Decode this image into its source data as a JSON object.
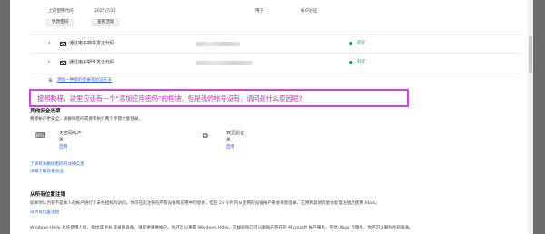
{
  "top": {
    "last_used_label": "上次使用时间",
    "last_used_value": "2025/7/20",
    "type_label": "用于",
    "type_value": "帐户验证",
    "change_password_btn": "更改密码",
    "view_activity_btn": "查看活动"
  },
  "methods": [
    {
      "label": "通过电子邮件发送代码",
      "status": "验证"
    },
    {
      "label": "通过电子邮件发送代码",
      "status": "验证"
    }
  ],
  "add_method_link": "添加一种新的登录或验证方法",
  "annotation": "按照教程，这里应该有一个“添加应用密码”的框块，但是我的帐号没有，请问是什么原因呢?",
  "advanced": {
    "title": "其他安全选项",
    "desc": "要使帐户更安全，请删除密码或要求执行两个步骤才能登录。",
    "passwordless": {
      "title": "无密码帐户",
      "state": "关",
      "action": "启用"
    },
    "two_step": {
      "title": "双重验证",
      "state": "关",
      "action": "启用"
    },
    "link1": "了解有关删除密码的详细信息",
    "link2": "详细了解双重验证"
  },
  "sign_out": {
    "title": "从所有位置注销",
    "desc": "如果你认为有不是本人的帐户进行了未经授权的访问，你可在此注销在所有设备和应用中的登录，但在 24 小时内从使用的设备帐户将会重新登录。应用和其他可能会处理注销后使用 Xbox。",
    "link": "从所有位置注销",
    "footer": "Windows Hello 允许使用人脸、指纹或 PIN 登录到设备，请提供重要帐户。你还可以重置 Windows Hello，这样删除它可以删除已存在在 Microsoft 帐户服务，包括 Xbox 云服务，你还可以删除你的设备。"
  }
}
